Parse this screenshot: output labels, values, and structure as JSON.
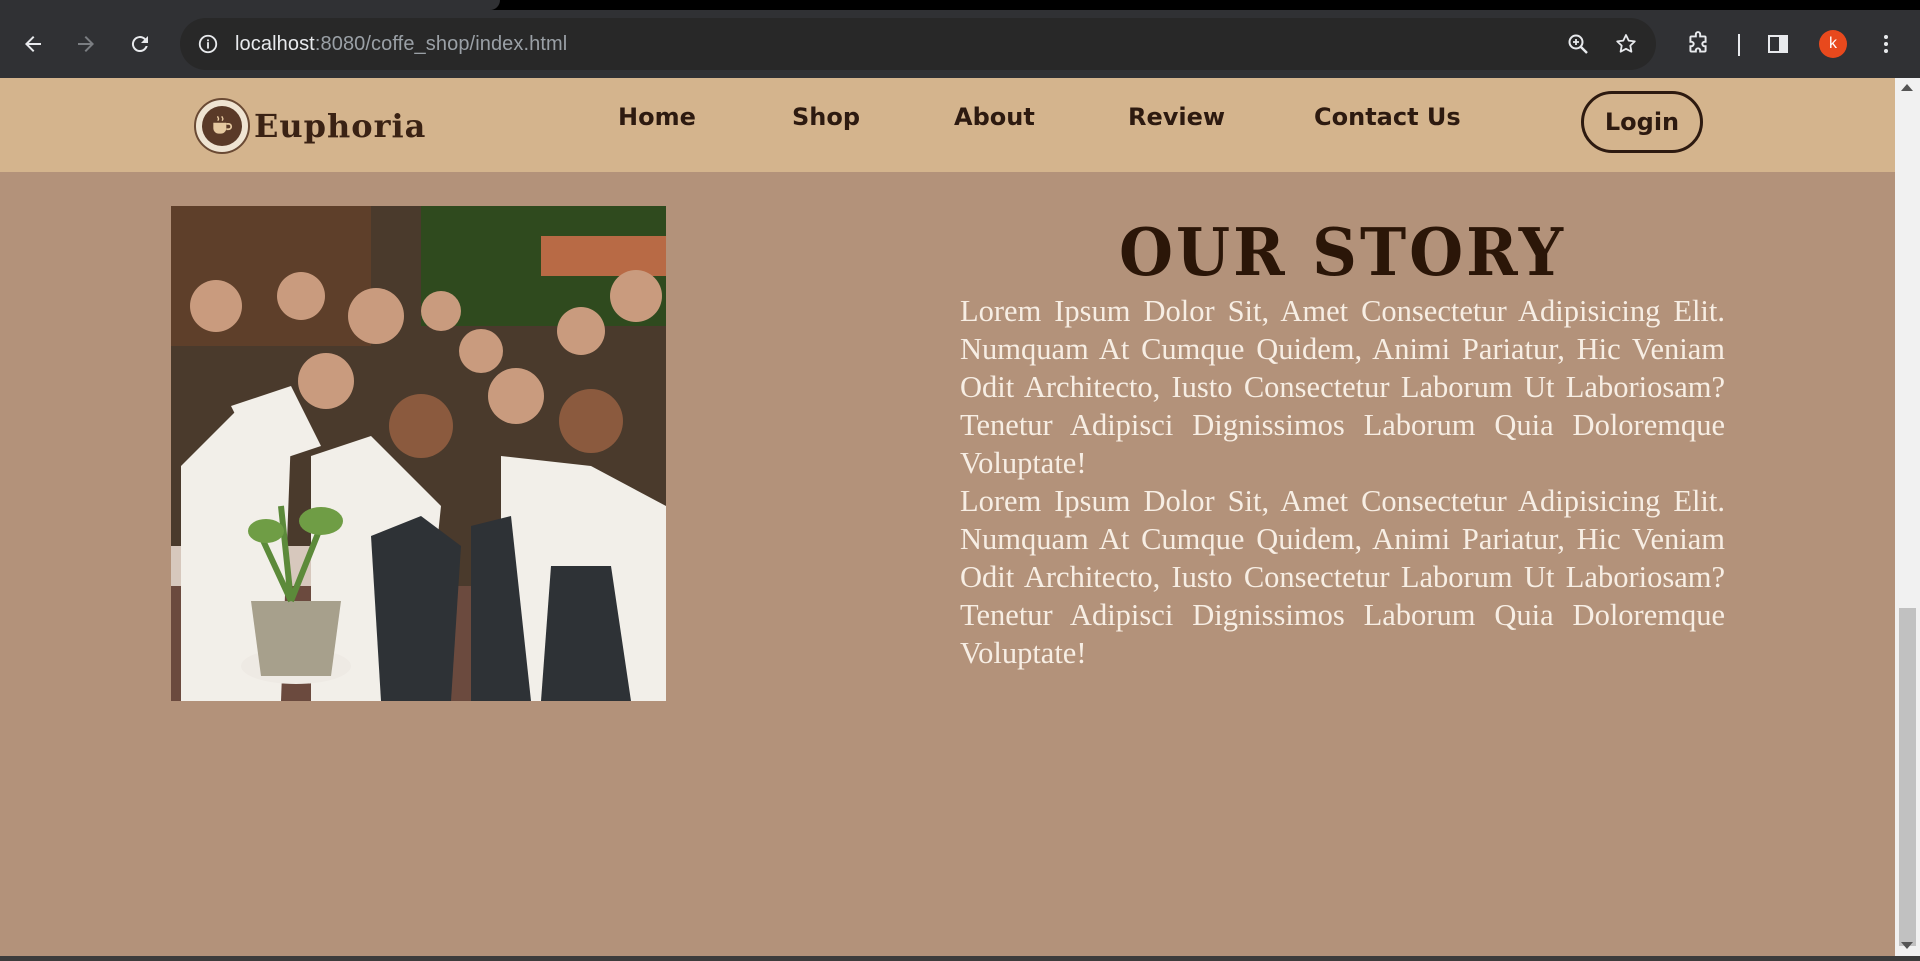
{
  "browser": {
    "url_host": "localhost",
    "url_path": ":8080/coffe_shop/index.html",
    "profile_initial": "k",
    "icons": [
      "back-icon",
      "forward-icon",
      "reload-icon",
      "site-info-icon",
      "zoom-icon",
      "bookmark-star-icon",
      "extensions-icon",
      "side-panel-icon",
      "menu-dots-icon"
    ]
  },
  "site": {
    "brand": "Euphoria",
    "nav": [
      "Home",
      "Shop",
      "About",
      "Review",
      "Contact Us"
    ],
    "login_label": "Login"
  },
  "story": {
    "title": "OUR STORY",
    "paragraph_1": "Lorem Ipsum Dolor Sit, Amet Consectetur Adipisicing Elit. Numquam At Cumque Quidem, Animi Pariatur, Hic Veniam Odit Architecto, Iusto Consectetur Laborum Ut Laboriosam? Tenetur Adipisci Dignissimos Laborum Quia Doloremque Voluptate!",
    "paragraph_2": "Lorem Ipsum Dolor Sit, Amet Consectetur Adipisicing Elit. Numquam At Cumque Quidem, Animi Pariatur, Hic Veniam Odit Architecto, Iusto Consectetur Laborum Ut Laboriosam? Tenetur Adipisci Dignissimos Laborum Quia Doloremque Voluptate!"
  },
  "colors": {
    "page_bg": "#b3927a",
    "header_bg": "#d4b48d",
    "title_color": "#2b1608",
    "text_color": "#f7eee4"
  }
}
